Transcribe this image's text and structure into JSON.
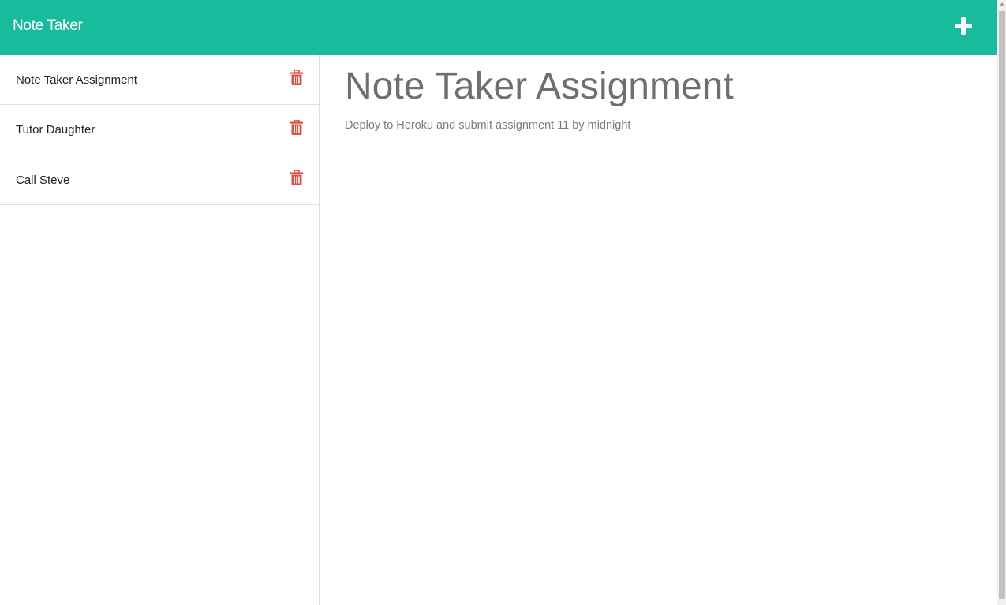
{
  "navbar": {
    "brand": "Note Taker",
    "add_icon": "plus-icon",
    "background": "#18bc9c"
  },
  "sidebar": {
    "notes": [
      {
        "title": "Note Taker Assignment",
        "icon": "trash-icon"
      },
      {
        "title": "Tutor Daughter",
        "icon": "trash-icon"
      },
      {
        "title": "Call Steve",
        "icon": "trash-icon"
      }
    ],
    "trash_color": "#e74c3c"
  },
  "main": {
    "note_title": "Note Taker Assignment",
    "note_text": "Deploy to Heroku and submit assignment 11 by midnight"
  }
}
